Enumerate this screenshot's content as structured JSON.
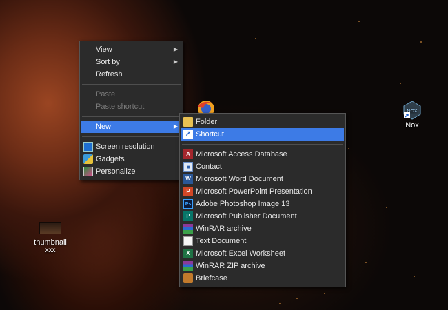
{
  "desktop": {
    "icons": [
      {
        "label": "thumbnail",
        "sublabel": "xxx"
      },
      {
        "label": "Nox"
      }
    ]
  },
  "context_menu": {
    "items": [
      {
        "label": "View",
        "submenu": true
      },
      {
        "label": "Sort by",
        "submenu": true
      },
      {
        "label": "Refresh"
      },
      {
        "label": "Paste",
        "disabled": true
      },
      {
        "label": "Paste shortcut",
        "disabled": true
      },
      {
        "label": "New",
        "submenu": true,
        "highlighted": true
      },
      {
        "label": "Screen resolution",
        "icon": "screen-resolution-icon"
      },
      {
        "label": "Gadgets",
        "icon": "gadgets-icon"
      },
      {
        "label": "Personalize",
        "icon": "personalize-icon"
      }
    ]
  },
  "new_submenu": {
    "items": [
      {
        "label": "Folder",
        "icon": "folder-icon"
      },
      {
        "label": "Shortcut",
        "icon": "shortcut-icon",
        "highlighted": true
      },
      {
        "label": "Microsoft Access Database",
        "icon": "access-icon"
      },
      {
        "label": "Contact",
        "icon": "contact-icon"
      },
      {
        "label": "Microsoft Word Document",
        "icon": "word-icon"
      },
      {
        "label": "Microsoft PowerPoint Presentation",
        "icon": "powerpoint-icon"
      },
      {
        "label": "Adobe Photoshop Image 13",
        "icon": "photoshop-icon"
      },
      {
        "label": "Microsoft Publisher Document",
        "icon": "publisher-icon"
      },
      {
        "label": "WinRAR archive",
        "icon": "winrar-icon"
      },
      {
        "label": "Text Document",
        "icon": "text-document-icon"
      },
      {
        "label": "Microsoft Excel Worksheet",
        "icon": "excel-icon"
      },
      {
        "label": "WinRAR ZIP archive",
        "icon": "winrar-zip-icon"
      },
      {
        "label": "Briefcase",
        "icon": "briefcase-icon"
      }
    ]
  },
  "colors": {
    "menu_bg": "#2b2b2b",
    "highlight": "#3d7be6",
    "text": "#e6e6e6",
    "disabled_text": "#7c7c7c"
  }
}
